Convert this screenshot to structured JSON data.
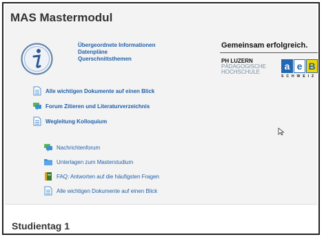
{
  "course": {
    "title": "MAS Mastermodul"
  },
  "info_links": [
    "Übergeordnete Informationen",
    "Datenpläne",
    "Querschnittsthemen"
  ],
  "logos": {
    "tagline": "Gemeinsam erfolgreich.",
    "ph_name": "PH LUZERN",
    "ph_line1": "PÄDAGOGISCHE",
    "ph_line2": "HOCHSCHULE",
    "aeb_a": "a",
    "aeb_e": "e",
    "aeb_b": "B",
    "aeb_sub": "SCHWEIZ"
  },
  "main_links": [
    {
      "label": "Alle wichtigen Dokumente auf einen Blick",
      "icon": "page-icon"
    },
    {
      "label": "Forum Zitieren und Literaturverzeichnis",
      "icon": "forum-icon"
    },
    {
      "label": "Wegleitung Kolloquium",
      "icon": "page-icon"
    }
  ],
  "sub_links": [
    {
      "label": "Nachrichtenforum",
      "icon": "forum-icon"
    },
    {
      "label": "Unterlagen zum Masterstudium",
      "icon": "folder-icon"
    },
    {
      "label": "FAQ: Antworten auf die häufigsten Fragen",
      "icon": "glossary-icon"
    },
    {
      "label": "Alle wichtigen Dokumente auf einen Blick",
      "icon": "page-icon"
    }
  ],
  "next_section": {
    "title": "Studientag 1"
  }
}
